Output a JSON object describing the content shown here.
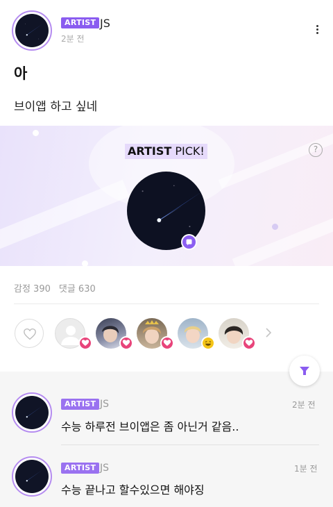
{
  "post": {
    "author": {
      "badge": "ARTIST",
      "name": "JS",
      "time": "2분 전"
    },
    "title": "아",
    "body": "브이앱 하고 싶네"
  },
  "artist_pick": {
    "title_bold": "ARTIST",
    "title_rest": " PICK!",
    "help": "?"
  },
  "stats": {
    "reactions": "감정 390",
    "comments": "댓글 630"
  },
  "reactors": [
    {
      "reaction": "heart",
      "reaction_color": "#e8447a"
    },
    {
      "reaction": "heart",
      "reaction_color": "#e8447a"
    },
    {
      "reaction": "heart",
      "reaction_color": "#e8447a"
    },
    {
      "reaction": "laugh",
      "reaction_color": "#f5c518"
    },
    {
      "reaction": "heart",
      "reaction_color": "#e8447a"
    }
  ],
  "comments": [
    {
      "badge": "ARTIST",
      "name": "JS",
      "time": "2분 전",
      "text": "수능 하루전 브이앱은 좀 아닌거 같음.."
    },
    {
      "badge": "ARTIST",
      "name": "JS",
      "time": "1분 전",
      "text": "수능 끝나고 할수있으면 해야징"
    }
  ],
  "colors": {
    "accent": "#8a5cf0",
    "heart": "#e8447a"
  }
}
